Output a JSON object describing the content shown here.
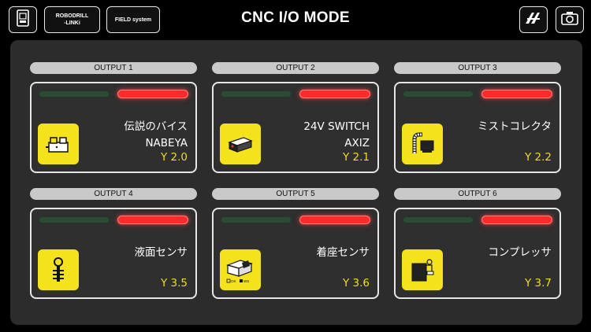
{
  "header": {
    "title": "CNC I/O MODE",
    "robodrill_label": "ROBODRILL",
    "robodrill_sub": "-LINKi",
    "field_label": "FIELD system"
  },
  "icons": {
    "home": "machine-icon",
    "axiz": "axiz-logo-icon",
    "camera": "camera-rotate-icon"
  },
  "outputs": [
    {
      "label": "OUTPUT 1",
      "line1": "伝説のバイス",
      "line2": "NABEYA",
      "code": "Y 2.0",
      "icon": "vise-icon",
      "green_on": false,
      "red_on": true
    },
    {
      "label": "OUTPUT 2",
      "line1": "24V SWITCH",
      "line2": "AXIZ",
      "code": "Y 2.1",
      "icon": "switch-box-icon",
      "green_on": false,
      "red_on": true
    },
    {
      "label": "OUTPUT 3",
      "line1": "ミストコレクタ",
      "line2": "",
      "code": "Y 2.2",
      "icon": "mist-collector-icon",
      "green_on": false,
      "red_on": true
    },
    {
      "label": "OUTPUT 4",
      "line1": "液面センサ",
      "line2": "",
      "code": "Y 3.5",
      "icon": "level-sensor-icon",
      "green_on": false,
      "red_on": true
    },
    {
      "label": "OUTPUT 5",
      "line1": "着座センサ",
      "line2": "",
      "code": "Y 3.6",
      "icon": "seating-sensor-icon",
      "green_on": false,
      "red_on": true,
      "icon_legend_a": "OK",
      "icon_legend_b": "WS"
    },
    {
      "label": "OUTPUT 6",
      "line1": "コンプレッサ",
      "line2": "",
      "code": "Y 3.7",
      "icon": "compressor-icon",
      "green_on": false,
      "red_on": true
    }
  ],
  "colors": {
    "accent_yellow": "#f4e21c",
    "led_red": "#ff2a2a",
    "led_green_off": "#2d4a34",
    "panel": "#2c2c2c"
  }
}
